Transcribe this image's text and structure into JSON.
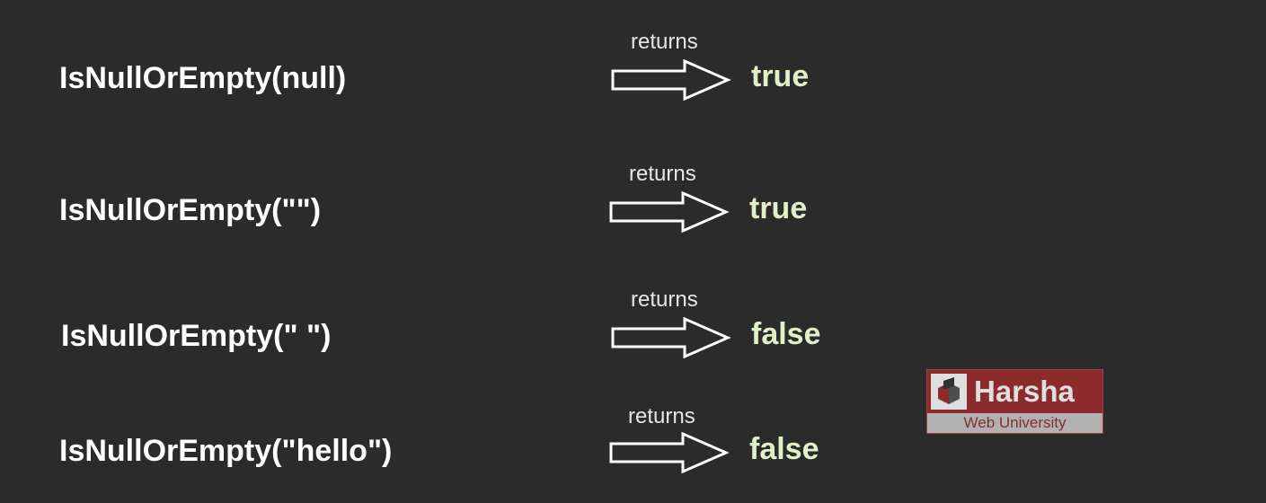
{
  "colors": {
    "background": "#2b2b2b",
    "expression_text": "#ffffff",
    "result_text": "#e0f0c8",
    "returns_text": "#e6e6e6",
    "logo_red": "#9e2b2b"
  },
  "rows": [
    {
      "expression": "IsNullOrEmpty(null)",
      "returns_label": "returns",
      "result": "true"
    },
    {
      "expression": "IsNullOrEmpty(\"\")",
      "returns_label": "returns",
      "result": "true"
    },
    {
      "expression": "IsNullOrEmpty(\" \")",
      "returns_label": "returns",
      "result": "false"
    },
    {
      "expression": "IsNullOrEmpty(\"hello\")",
      "returns_label": "returns",
      "result": "false"
    }
  ],
  "logo": {
    "title": "Harsha",
    "subtitle": "Web University",
    "icon": "harsha-logo-icon"
  }
}
